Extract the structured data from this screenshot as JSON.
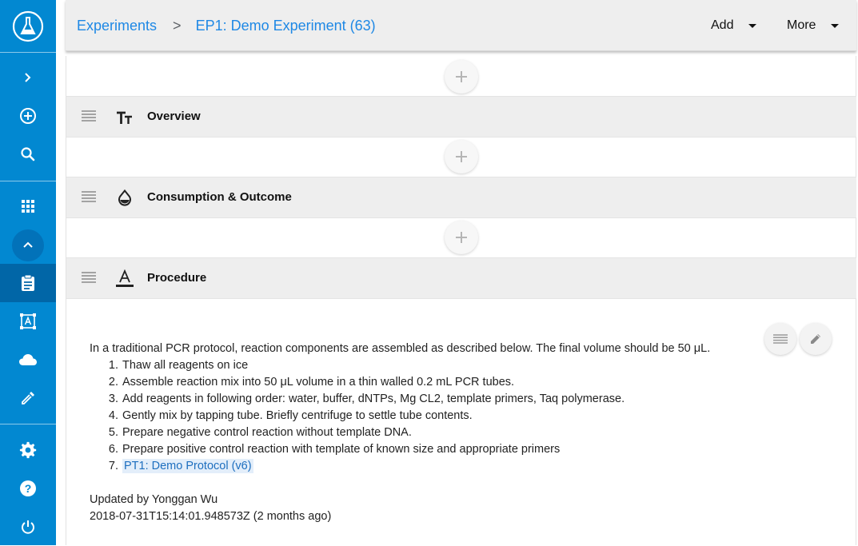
{
  "header": {
    "breadcrumb_root": "Experiments",
    "breadcrumb_separator": ">",
    "breadcrumb_current": "EP1: Demo Experiment (63)",
    "add_menu_label": "Add",
    "more_menu_label": "More"
  },
  "sidebar": {
    "icons": [
      "logo-icon",
      "chevron-right-icon",
      "add-circle-icon",
      "search-icon",
      "apps-grid-icon",
      "chevron-up-icon",
      "clipboard-icon",
      "selection-icon",
      "cloud-icon",
      "eyedropper-icon",
      "gear-icon",
      "help-icon",
      "power-icon"
    ],
    "accent": "#0288d1",
    "active_bg": "#0166a7"
  },
  "sections": [
    {
      "title": "Overview",
      "icon": "text-format-icon"
    },
    {
      "title": "Consumption & Outcome",
      "icon": "drop-icon"
    },
    {
      "title": "Procedure",
      "icon": "format-color-text-icon"
    }
  ],
  "procedure": {
    "intro": "In a traditional PCR protocol, reaction components are assembled as described below. The final volume should be 50 μL.",
    "steps": [
      "Thaw all reagents on ice",
      "Assemble reaction mix into 50 μL volume in a thin walled 0.2 mL PCR tubes.",
      "Add reagents in following order: water, buffer, dNTPs, Mg CL2, template primers, Taq polymerase.",
      "Gently mix by tapping tube. Briefly centrifuge to settle tube contents.",
      "Prepare negative control reaction without template DNA.",
      "Prepare positive control reaction with template of known size and appropriate primers"
    ],
    "linked_protocol": "PT1: Demo Protocol (v6)",
    "updated_by": "Updated by Yonggan Wu",
    "updated_at": "2018-07-31T15:14:01.948573Z (2 months ago)"
  }
}
